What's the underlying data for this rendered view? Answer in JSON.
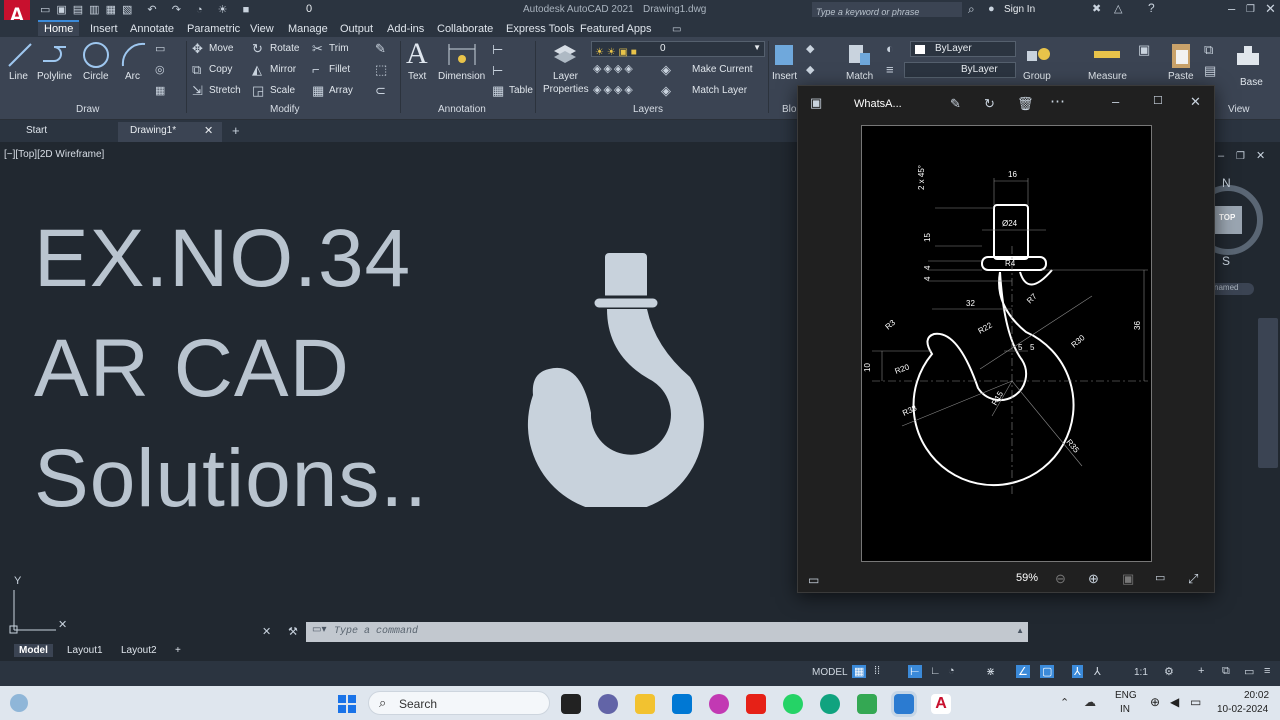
{
  "app": {
    "title": "Autodesk AutoCAD 2021",
    "document": "Drawing1.dwg",
    "search_placeholder": "Type a keyword or phrase",
    "sign_in": "Sign In",
    "qat_layer_value": "0"
  },
  "ribbon_tabs": [
    "Home",
    "Insert",
    "Annotate",
    "Parametric",
    "View",
    "Manage",
    "Output",
    "Add-ins",
    "Collaborate",
    "Express Tools",
    "Featured Apps"
  ],
  "draw": {
    "line": "Line",
    "polyline": "Polyline",
    "circle": "Circle",
    "arc": "Arc",
    "group": "Draw"
  },
  "modify": {
    "move": "Move",
    "rotate": "Rotate",
    "trim": "Trim",
    "copy": "Copy",
    "mirror": "Mirror",
    "fillet": "Fillet",
    "stretch": "Stretch",
    "scale": "Scale",
    "array": "Array",
    "group": "Modify"
  },
  "annotation": {
    "text": "Text",
    "dimension": "Dimension",
    "table": "Table",
    "group": "Annotation"
  },
  "layers": {
    "layer_properties_1": "Layer",
    "layer_properties_2": "Properties",
    "make_current": "Make Current",
    "match_layer": "Match Layer",
    "layer_value": "0",
    "group": "Layers"
  },
  "block": {
    "insert": "Insert",
    "group": "Blo"
  },
  "properties": {
    "match": "Match",
    "bylayer_1": "ByLayer",
    "bylayer_2": "ByLayer"
  },
  "groups": {
    "group": "Group"
  },
  "utilities": {
    "measure": "Measure"
  },
  "clipboard": {
    "paste": "Paste"
  },
  "view": {
    "base": "Base",
    "group": "View"
  },
  "doc_tabs": [
    "Start",
    "Drawing1*"
  ],
  "viewport_label": "[−][Top][2D Wireframe]",
  "overlay_text": {
    "line1": "EX.NO.34",
    "line2": "AR CAD",
    "line3": "Solutions.."
  },
  "viewcube": {
    "north": "N",
    "south": "S",
    "top": "TOP",
    "unnamed": "named"
  },
  "photos": {
    "title": "WhatsA...",
    "zoom": "59%"
  },
  "drawing_dims": {
    "d_2x45": "2 x 45°",
    "d_16": "16",
    "d_phi24": "Ø24",
    "d_15": "15",
    "d_4a": "4",
    "d_4b": "4",
    "d_R4": "R4",
    "d_R7": "R7",
    "d_32": "32",
    "d_R3": "R3",
    "d_R22": "R22",
    "d_R30": "R30",
    "d_36": "36",
    "d_5a": "5",
    "d_5b": "5",
    "d_10": "10",
    "d_R20": "R20",
    "d_R38": "R38",
    "d_R15": "R15",
    "d_R35": "R35"
  },
  "command": {
    "placeholder": "Type a command"
  },
  "layout_tabs": [
    "Model",
    "Layout1",
    "Layout2"
  ],
  "status": {
    "model": "MODEL",
    "scale": "1:1"
  },
  "taskbar": {
    "search": "Search",
    "lang_1": "ENG",
    "lang_2": "IN",
    "time": "20:02",
    "date": "10-02-2024"
  },
  "colors": {
    "accent": "#3b8ad9",
    "autocad_red": "#c8102e",
    "hook": "#c8d2dc"
  }
}
